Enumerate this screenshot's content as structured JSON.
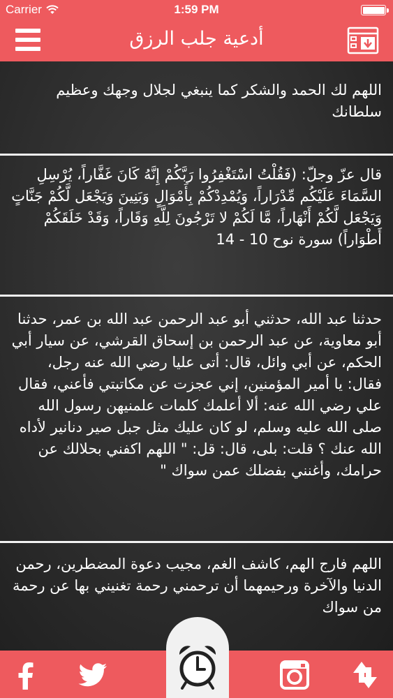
{
  "status_bar": {
    "carrier": "Carrier",
    "time": "1:59 PM"
  },
  "nav": {
    "title": "أدعية جلب الرزق"
  },
  "cards": [
    {
      "text": "اللهم لك الحمد والشكر كما ينبغي لجلال وجهك وعظيم سلطانك"
    },
    {
      "text": "قال عزّ وجلّ: (فَقُلْتُ اسْتَغْفِرُوا رَبَّكُمْ إِنَّهُ كَانَ غَفَّاراً، يُرْسِلِ السَّمَاءَ عَلَيْكُم مِّدْرَاراً، وَيُمْدِدْكُمْ بِأَمْوَالٍ وَبَنِينَ وَيَجْعَل لَّكُمْ جَنَّاتٍ وَيَجْعَل لَّكُمْ أَنْهَاراً، مَّا لَكُمْ لا تَرْجُونَ لِلَّهِ وَقَاراً، وَقَدْ خَلَقَكُمْ أَطْوَاراً) سورة نوح 10 - 14"
    },
    {
      "text": "حدثنا عبد الله، حدثني أبو عبد الرحمن عبد الله بن عمر، حدثنا أبو معاوية، عن عبد الرحمن بن إسحاق القرشي، عن سيار أبي الحكم، عن أبي وائل، قال: أتى عليا رضي الله عنه رجل، فقال: يا أمير المؤمنين، إني عجزت عن مكاتبتي فأعني، فقال علي رضي الله عنه: ألا أعلمك كلمات علمنيهن رسول الله صلى الله عليه وسلم، لو كان عليك مثل جبل صير دنانير لأداه الله عنك ؟ قلت: بلى، قال: قل: \" اللهم اكفني بحلالك عن حرامك، وأغنني بفضلك عمن سواك \""
    },
    {
      "text": "اللهم فارج الهم، كاشف الغم، مجيب دعوة المضطرين، رحمن الدنيا والآخرة ورحيمهما أن ترحمني رحمة تغنيني بها عن رحمة من سواك"
    }
  ],
  "icons": {
    "menu": "hamburger-menu-icon",
    "save": "save-download-icon",
    "facebook": "facebook-icon",
    "twitter": "twitter-icon",
    "alarm": "alarm-clock-icon",
    "instagram": "instagram-icon",
    "share": "share-arrows-icon"
  },
  "colors": {
    "accent": "#ee5a5e",
    "background": "#2a2a2a",
    "text": "#ffffff",
    "alarm_bg": "#f1f1f1"
  }
}
